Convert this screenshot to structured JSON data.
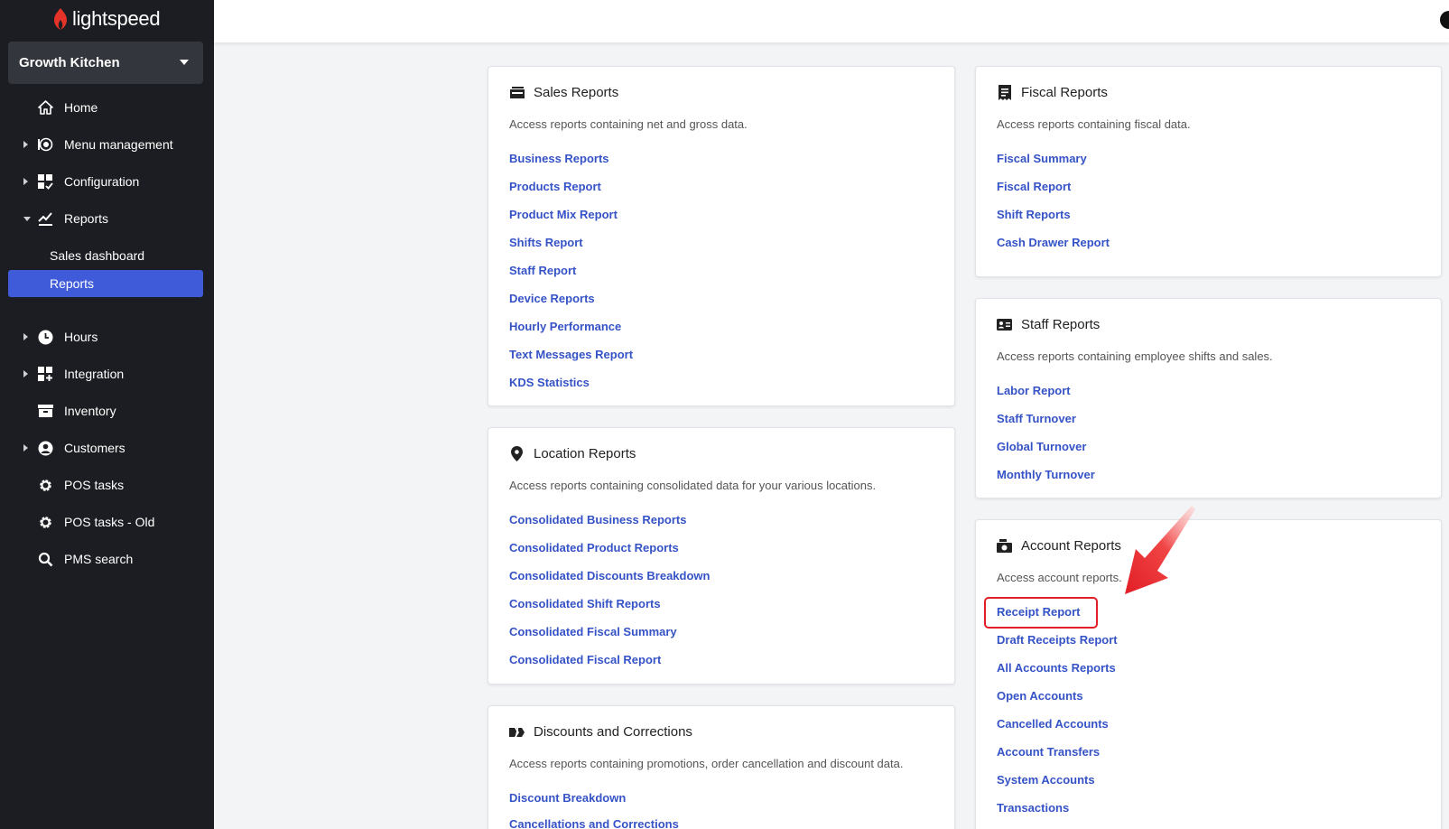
{
  "brand": {
    "name": "lightspeed",
    "color": "#e6332a"
  },
  "venue": {
    "name": "Growth Kitchen"
  },
  "sidebar": {
    "items": [
      {
        "label": "Home",
        "icon": "home-icon"
      },
      {
        "label": "Menu management",
        "icon": "menu-management-icon"
      },
      {
        "label": "Configuration",
        "icon": "configuration-icon"
      },
      {
        "label": "Reports",
        "icon": "chart-icon"
      },
      {
        "label": "Hours",
        "icon": "clock-icon"
      },
      {
        "label": "Integration",
        "icon": "integration-icon"
      },
      {
        "label": "Inventory",
        "icon": "inventory-icon"
      },
      {
        "label": "Customers",
        "icon": "user-icon"
      },
      {
        "label": "POS tasks",
        "icon": "gear-icon"
      },
      {
        "label": "POS tasks - Old",
        "icon": "gear-icon"
      },
      {
        "label": "PMS search",
        "icon": "search-icon"
      }
    ],
    "sub_items": [
      {
        "label": "Sales dashboard"
      },
      {
        "label": "Reports",
        "active": true
      }
    ]
  },
  "cards": {
    "sales": {
      "title": "Sales Reports",
      "desc": "Access reports containing net and gross data.",
      "links": [
        "Business Reports",
        "Products Report",
        "Product Mix Report",
        "Shifts Report",
        "Staff Report",
        "Device Reports",
        "Hourly Performance",
        "Text Messages Report",
        "KDS Statistics"
      ]
    },
    "location": {
      "title": "Location Reports",
      "desc": "Access reports containing consolidated data for your various locations.",
      "links": [
        "Consolidated Business Reports",
        "Consolidated Product Reports",
        "Consolidated Discounts Breakdown",
        "Consolidated Shift Reports",
        "Consolidated Fiscal Summary",
        "Consolidated Fiscal Report"
      ]
    },
    "discounts": {
      "title": "Discounts and Corrections",
      "desc": "Access reports containing promotions, order cancellation and discount data.",
      "links": [
        "Discount Breakdown",
        "Cancellations and Corrections"
      ]
    },
    "fiscal": {
      "title": "Fiscal Reports",
      "desc": "Access reports containing fiscal data.",
      "links": [
        "Fiscal Summary",
        "Fiscal Report",
        "Shift Reports",
        "Cash Drawer Report"
      ]
    },
    "staff": {
      "title": "Staff Reports",
      "desc": "Access reports containing employee shifts and sales.",
      "links": [
        "Labor Report",
        "Staff Turnover",
        "Global Turnover",
        "Monthly Turnover"
      ]
    },
    "account": {
      "title": "Account Reports",
      "desc": "Access account reports.",
      "links": [
        "Receipt Report",
        "Draft Receipts Report",
        "All Accounts Reports",
        "Open Accounts",
        "Cancelled Accounts",
        "Account Transfers",
        "System Accounts",
        "Transactions"
      ]
    }
  },
  "colors": {
    "link": "#3553c6",
    "sidebar_bg": "#1c1d22",
    "active": "#3f5bd9",
    "annotation": "#e11e26"
  }
}
